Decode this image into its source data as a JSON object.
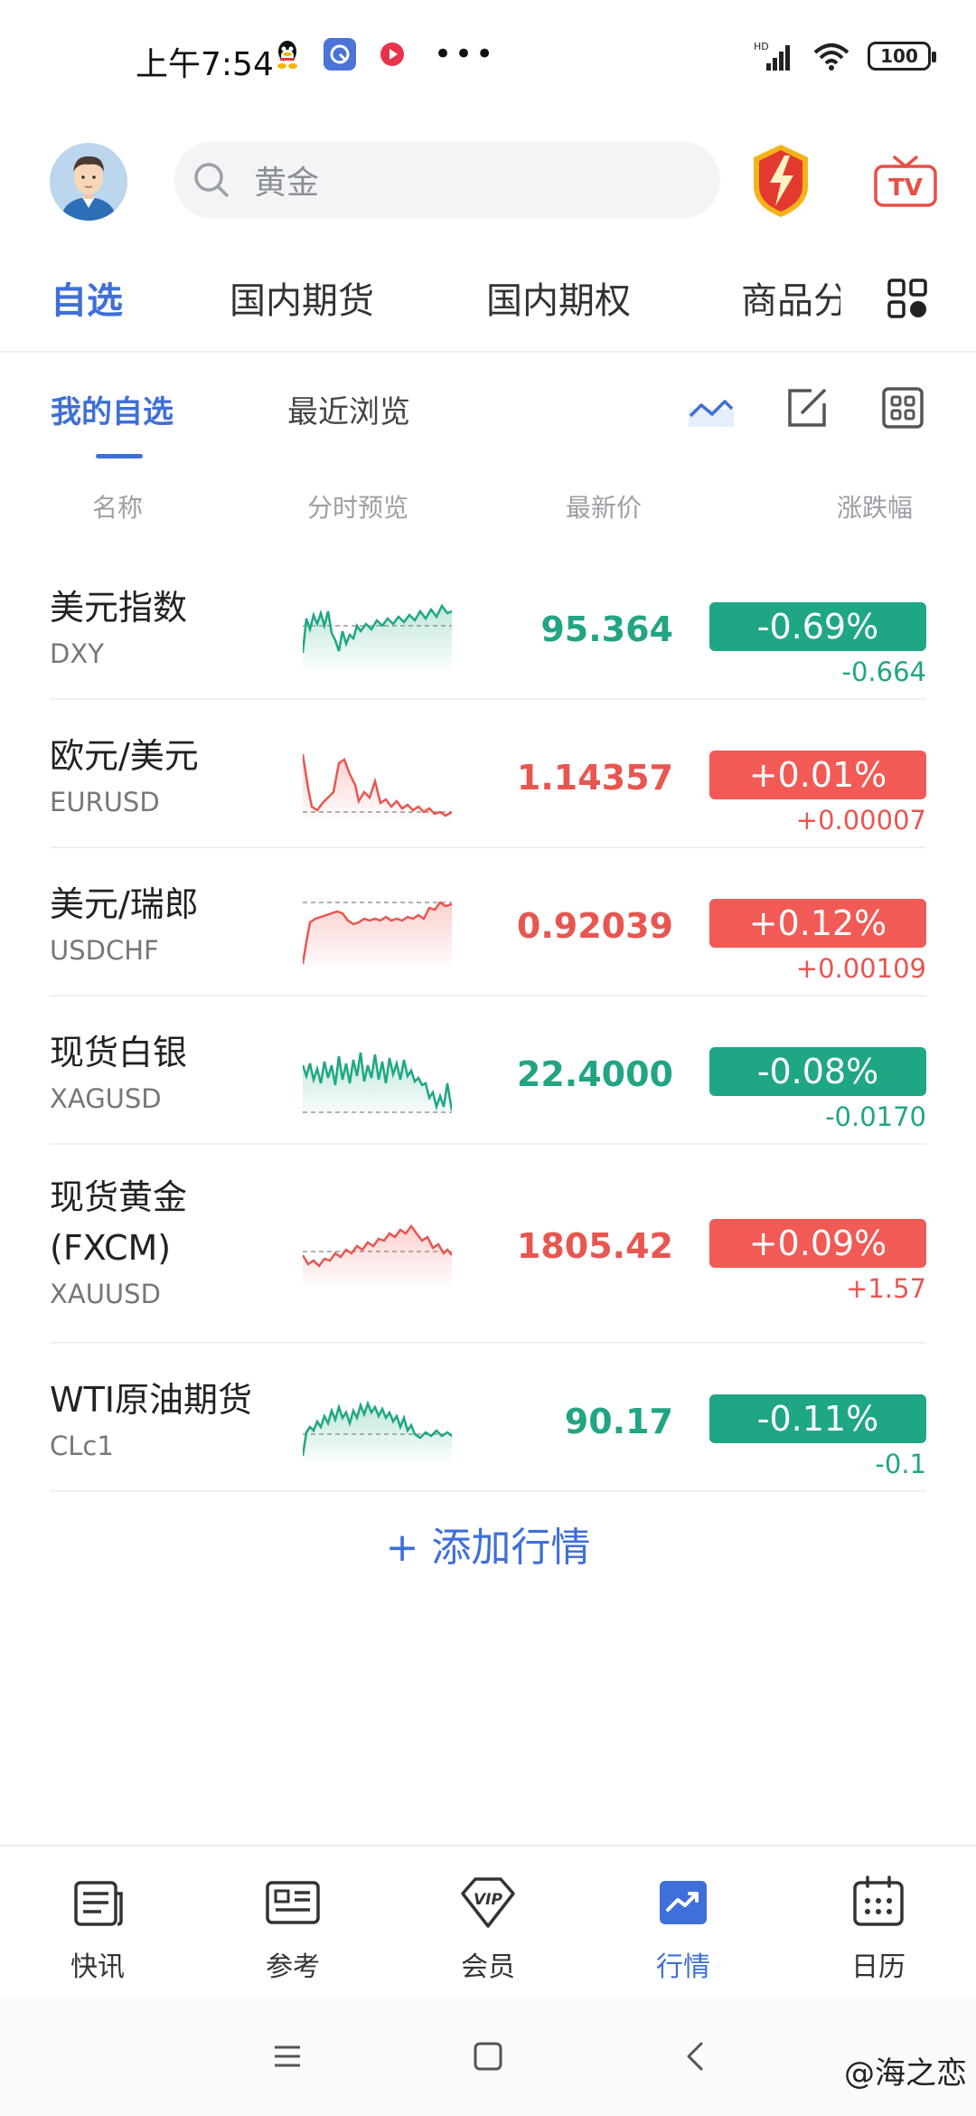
{
  "status_bar": {
    "time": "上午7:54",
    "battery": "100"
  },
  "search": {
    "placeholder": "黄金"
  },
  "category_tabs": [
    {
      "label": "自选",
      "active": true
    },
    {
      "label": "国内期货",
      "active": false
    },
    {
      "label": "国内期权",
      "active": false
    },
    {
      "label": "商品分",
      "active": false
    }
  ],
  "sub_tabs": [
    {
      "label": "我的自选",
      "active": true
    },
    {
      "label": "最近浏览",
      "active": false
    }
  ],
  "columns": [
    "名称",
    "分时预览",
    "最新价",
    "涨跌幅"
  ],
  "rows": [
    {
      "name": "美元指数",
      "code": "DXY",
      "price": "95.364",
      "pct": "-0.69%",
      "change": "-0.664",
      "direction": "down"
    },
    {
      "name": "欧元/美元",
      "code": "EURUSD",
      "price": "1.14357",
      "pct": "+0.01%",
      "change": "+0.00007",
      "direction": "up"
    },
    {
      "name": "美元/瑞郎",
      "code": "USDCHF",
      "price": "0.92039",
      "pct": "+0.12%",
      "change": "+0.00109",
      "direction": "up"
    },
    {
      "name": "现货白银",
      "code": "XAGUSD",
      "price": "22.4000",
      "pct": "-0.08%",
      "change": "-0.0170",
      "direction": "down"
    },
    {
      "name": "现货黄金\n(FXCM)",
      "name_line1": "现货黄金",
      "name_line2": "(FXCM)",
      "code": "XAUUSD",
      "price": "1805.42",
      "pct": "+0.09%",
      "change": "+1.57",
      "direction": "up"
    },
    {
      "name": "WTI原油期货",
      "code": "CLc1",
      "price": "90.17",
      "pct": "-0.11%",
      "change": "-0.1",
      "direction": "down"
    }
  ],
  "add_label": "+ 添加行情",
  "bottom_nav": [
    {
      "label": "快讯",
      "icon": "news-icon",
      "active": false
    },
    {
      "label": "参考",
      "icon": "reference-icon",
      "active": false
    },
    {
      "label": "会员",
      "icon": "vip-icon",
      "active": false
    },
    {
      "label": "行情",
      "icon": "market-icon",
      "active": true
    },
    {
      "label": "日历",
      "icon": "calendar-icon",
      "active": false
    }
  ],
  "watermark": "@海之恋",
  "colors": {
    "accent": "#3f6fd8",
    "up": "#f15a55",
    "down": "#1fa785"
  }
}
